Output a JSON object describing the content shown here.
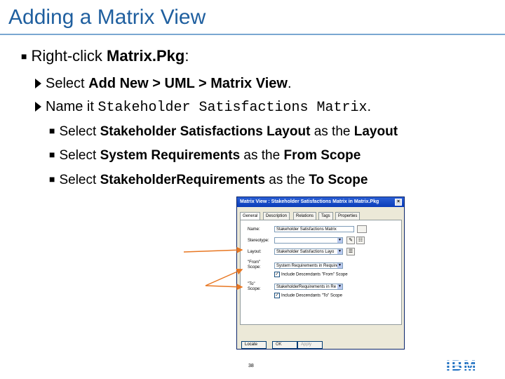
{
  "slide": {
    "title": "Adding a Matrix View",
    "bullet1": {
      "prefix": "Right-click ",
      "bold": "Matrix.Pkg",
      "suffix": ":"
    },
    "bullet2": {
      "prefix": "Select ",
      "bold": "Add New > UML > Matrix View",
      "suffix": "."
    },
    "bullet3": {
      "prefix": "Name it ",
      "mono": "Stakeholder Satisfactions Matrix",
      "suffix": "."
    },
    "sub": [
      {
        "prefix": "Select ",
        "bold1": "Stakeholder Satisfactions Layout",
        "mid": " as the ",
        "bold2": "Layout"
      },
      {
        "prefix": "Select ",
        "bold1": "System Requirements",
        "mid": " as the ",
        "bold2": "From Scope"
      },
      {
        "prefix": "Select ",
        "bold1": "StakeholderRequirements",
        "mid": " as the ",
        "bold2": "To Scope"
      }
    ],
    "page_number": "38"
  },
  "dialog": {
    "title": "Matrix View : Stakeholder Satisfactions Matrix in Matrix.Pkg",
    "tabs": [
      "General",
      "Description",
      "Relations",
      "Tags",
      "Properties"
    ],
    "labels": {
      "name": "Name:",
      "stereotype": "Stereotype:",
      "layout": "Layout:",
      "from_scope": "\"From\" Scope:",
      "to_scope": "\"To\" Scope:"
    },
    "values": {
      "name": "Stakeholder Satisfactions Matrix",
      "stereotype": "",
      "layout": "Stakeholder Satisfactions Layo",
      "from_scope": "System Requirements in Require",
      "to_scope": "StakeholderRequirements in Re"
    },
    "checkboxes": {
      "from_include": "Include Descendants \"From\" Scope",
      "to_include": "Include Descendants \"To\" Scope"
    },
    "buttons": {
      "locate": "Locate",
      "ok": "OK",
      "apply": "Apply"
    }
  },
  "colors": {
    "title": "#1f5f9f",
    "arrow": "#e87722",
    "ibm": "#1f70c1"
  },
  "logo": {
    "text": "IBM"
  }
}
